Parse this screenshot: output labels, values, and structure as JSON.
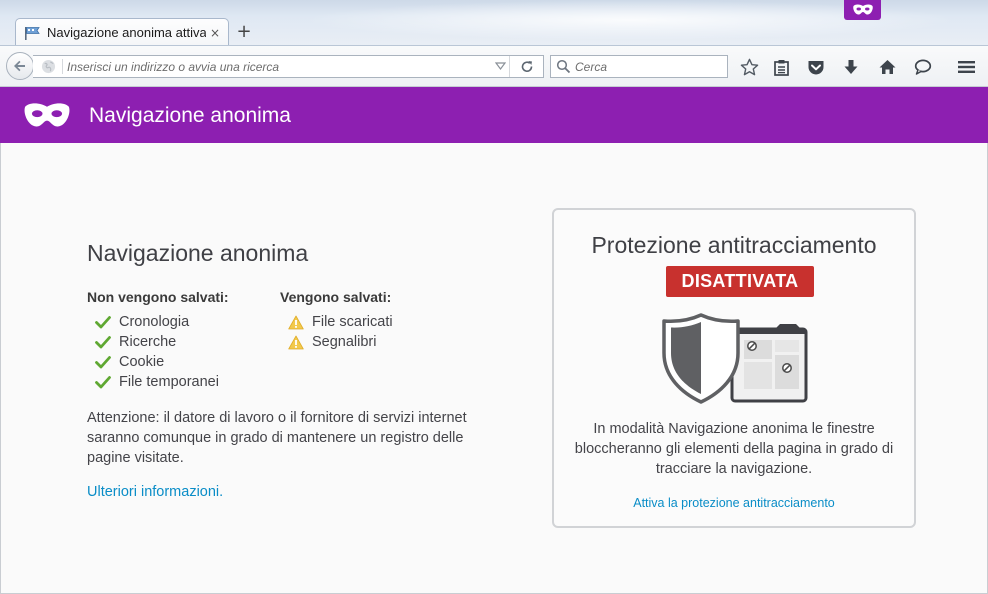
{
  "tab": {
    "title": "Navigazione anonima attiva",
    "close": "×",
    "new_tab": "+"
  },
  "navbar": {
    "url_placeholder": "Inserisci un indirizzo o avvia una ricerca",
    "search_placeholder": "Cerca"
  },
  "header": {
    "title": "Navigazione anonima"
  },
  "content": {
    "title": "Navigazione anonima",
    "not_saved": {
      "heading": "Non vengono salvati:",
      "items": [
        "Cronologia",
        "Ricerche",
        "Cookie",
        "File temporanei"
      ]
    },
    "saved": {
      "heading": "Vengono salvati:",
      "items": [
        "File scaricati",
        "Segnalibri"
      ]
    },
    "warning": "Attenzione: il datore di lavoro o il fornitore di servizi internet saranno comunque in grado di mantenere un registro delle pagine visitate.",
    "more_link": "Ulteriori informazioni."
  },
  "tracking": {
    "title": "Protezione antitracciamento",
    "status": "DISATTIVATA",
    "description": "In modalità Navigazione anonima le finestre bloccheranno gli elementi della pagina in grado di tracciare la navigazione.",
    "link": "Attiva la protezione antitracciamento"
  },
  "colors": {
    "accent": "#8d1fb1",
    "status_off": "#c8312e",
    "link": "#0a8dc7",
    "check": "#5fa832",
    "warning": "#f2c94c"
  },
  "icons": {
    "private_badge": "mask-icon",
    "favicon": "private-favicon-icon",
    "back": "back-arrow-icon",
    "globe": "globe-icon",
    "dropdown": "chevron-down-icon",
    "reload": "reload-icon",
    "search": "search-icon",
    "bookmark": "star-icon",
    "reading_list": "clipboard-icon",
    "pocket": "pocket-icon",
    "downloads": "download-icon",
    "home": "home-icon",
    "chat": "chat-bubble-icon",
    "menu": "hamburger-menu-icon",
    "check": "check-icon",
    "warning": "warning-icon",
    "shield": "shield-icon"
  }
}
